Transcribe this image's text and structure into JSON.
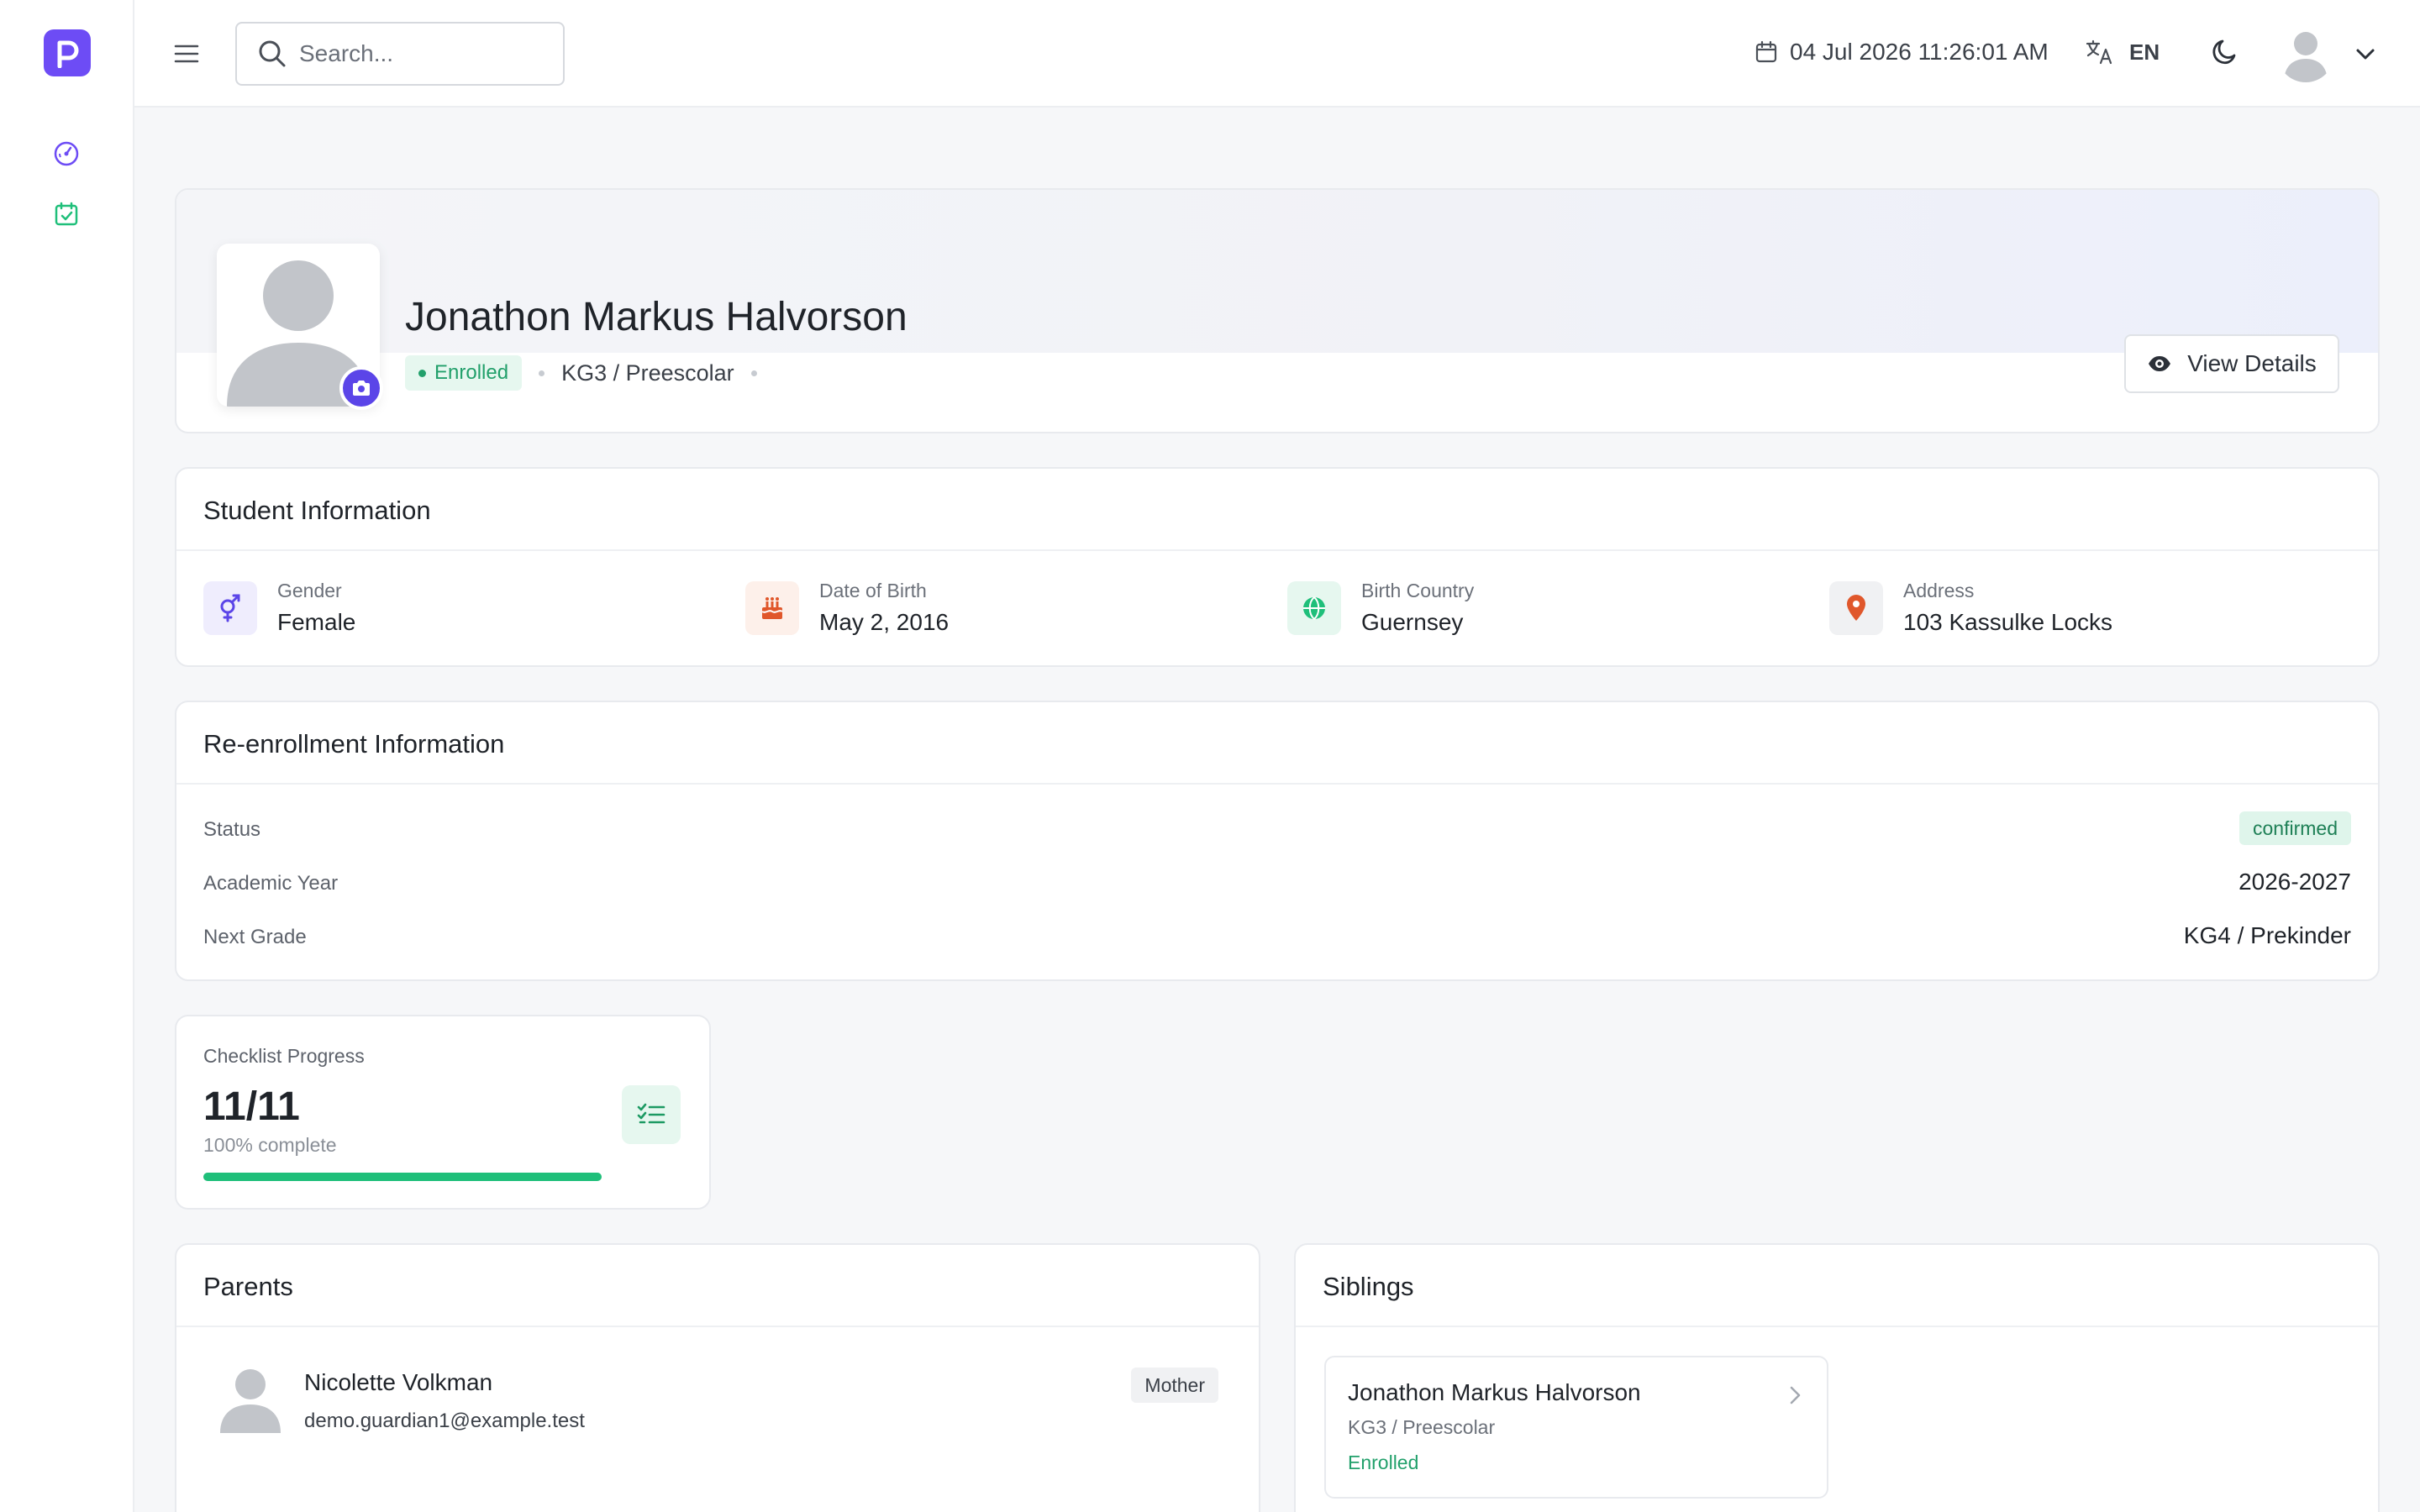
{
  "header": {
    "search_placeholder": "Search...",
    "datetime": "04 Jul 2026 11:26:01 AM",
    "language": "EN"
  },
  "profile": {
    "name": "Jonathon Markus Halvorson",
    "status": "Enrolled",
    "grade": "KG3 / Preescolar",
    "view_details_label": "View Details"
  },
  "student_info": {
    "title": "Student Information",
    "items": [
      {
        "label": "Gender",
        "value": "Female",
        "icon": "gender-icon",
        "color": "#5b45e8"
      },
      {
        "label": "Date of Birth",
        "value": "May 2, 2016",
        "icon": "birthday-cake-icon",
        "color": "#e0572b"
      },
      {
        "label": "Birth Country",
        "value": "Guernsey",
        "icon": "globe-icon",
        "color": "#1fbf7a"
      },
      {
        "label": "Address",
        "value": "103 Kassulke Locks",
        "icon": "location-pin-icon",
        "color": "#e0572b"
      }
    ]
  },
  "reenrollment": {
    "title": "Re-enrollment Information",
    "status_label": "Status",
    "status_value": "confirmed",
    "year_label": "Academic Year",
    "year_value": "2026-2027",
    "grade_label": "Next Grade",
    "grade_value": "KG4 / Prekinder"
  },
  "checklist": {
    "label": "Checklist Progress",
    "value": "11/11",
    "sub": "100% complete",
    "progress": 1.0
  },
  "parents": {
    "title": "Parents",
    "items": [
      {
        "name": "Nicolette Volkman",
        "email": "demo.guardian1@example.test",
        "relation": "Mother"
      }
    ]
  },
  "siblings": {
    "title": "Siblings",
    "items": [
      {
        "name": "Jonathon Markus Halvorson",
        "grade": "KG3 / Preescolar",
        "status": "Enrolled"
      }
    ]
  },
  "colors": {
    "brand": "#6d4cf5",
    "success": "#22a06b"
  }
}
